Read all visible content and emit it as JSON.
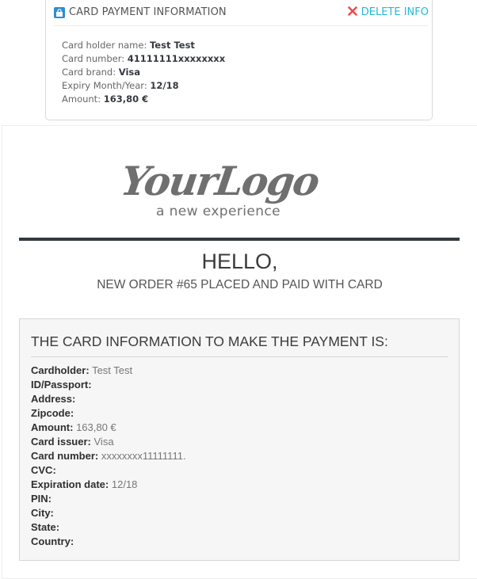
{
  "panel": {
    "title": "CARD PAYMENT INFORMATION",
    "delete_label": "DELETE INFO",
    "rows": [
      {
        "label": "Card holder name:",
        "value": "Test Test"
      },
      {
        "label": "Card number:",
        "value": "41111111xxxxxxxx"
      },
      {
        "label": "Card brand:",
        "value": "Visa"
      },
      {
        "label": "Expiry Month/Year:",
        "value": "12/18"
      },
      {
        "label": "Amount:",
        "value": "163,80 €"
      }
    ]
  },
  "email": {
    "logo_main": "YourLogo",
    "logo_sub": "a new experience",
    "greeting": "HELLO,",
    "order_line": "NEW ORDER #65 PLACED AND PAID WITH CARD",
    "card_title": "THE CARD INFORMATION TO MAKE THE PAYMENT IS:",
    "fields": [
      {
        "label": "Cardholder:",
        "value": "Test Test"
      },
      {
        "label": "ID/Passport:",
        "value": ""
      },
      {
        "label": "Address:",
        "value": ""
      },
      {
        "label": "Zipcode:",
        "value": ""
      },
      {
        "label": "Amount:",
        "value": "163,80 €"
      },
      {
        "label": "Card issuer:",
        "value": "Visa"
      },
      {
        "label": "Card number:",
        "value": "xxxxxxxx11111111."
      },
      {
        "label": "CVC:",
        "value": ""
      },
      {
        "label": "Expiration date:",
        "value": "12/18"
      },
      {
        "label": "PIN:",
        "value": ""
      },
      {
        "label": "City:",
        "value": ""
      },
      {
        "label": "State:",
        "value": ""
      },
      {
        "label": "Country:",
        "value": ""
      }
    ]
  },
  "icons": {
    "panel_icon": "lock-icon",
    "delete_icon": "close-icon"
  },
  "colors": {
    "accent": "#25b9d7",
    "delete_x": "#e84e4e",
    "lock_bg": "#2a8fd6",
    "rule": "#333a40",
    "card_box_bg": "#f6f6f6"
  }
}
